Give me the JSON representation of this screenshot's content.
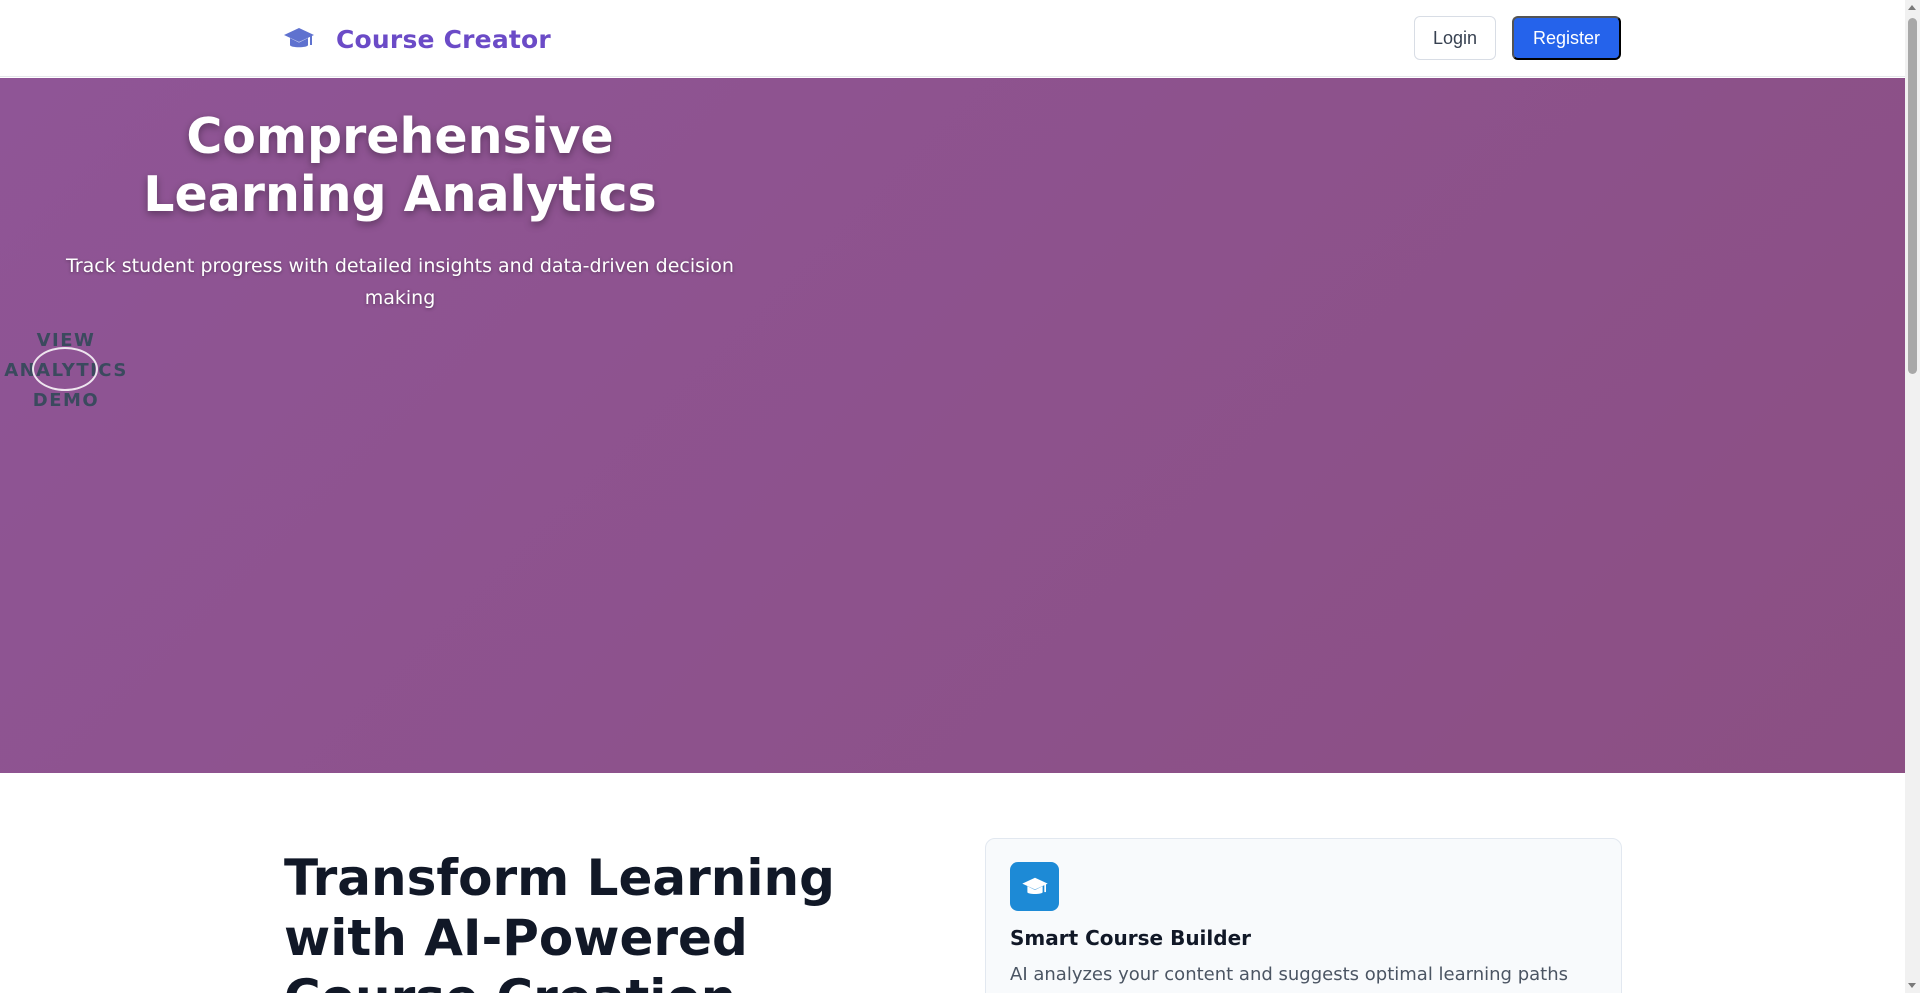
{
  "header": {
    "brand": "Course Creator",
    "login_label": "Login",
    "register_label": "Register"
  },
  "hero": {
    "title_line1": "Comprehensive",
    "title_line2": "Learning Analytics",
    "subtitle_line1": "Track student progress with detailed insights and data-driven decision",
    "subtitle_line2": "making",
    "cta_line1": "VIEW",
    "cta_line2": "ANALYTICS",
    "cta_line3": "DEMO"
  },
  "features": {
    "section_title_line1": "Transform Learning",
    "section_title_line2": "with AI-Powered",
    "section_title_line3": "Course Creation",
    "card": {
      "icon": "graduation-cap-icon",
      "title": "Smart Course Builder",
      "description": "AI analyzes your content and suggests optimal learning paths"
    }
  },
  "colors": {
    "brand": "#6b4bc7",
    "primary": "#2563eb",
    "hero_gradient_start": "#8f5596",
    "hero_gradient_end": "#8b4f83",
    "feature_icon_bg": "#1d8ad6"
  }
}
